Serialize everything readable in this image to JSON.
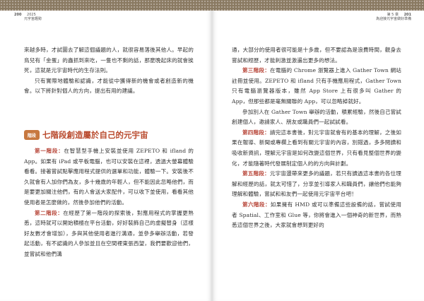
{
  "left_page": {
    "page_number": "200",
    "header_year": "2025",
    "header_title": "元宇宙趨勢",
    "intro_paragraphs": [
      "來越多時，才試圖去了解這個議題的人，就很容易落後其他人。早起的鳥兒有「金蛋」的蟲抓到來吃，一隻也不剩的話，那麼晚起床的就會挨死，這就是元宇宙時代的生存法則。",
      "只有實際地體驗和認識，才能從中獲得新的機會或者創造新的機會。以下將針對個人的方向，提出有用的建議。"
    ],
    "section_badge": "階段",
    "section_heading": "七階段創造屬於自己的元宇宙",
    "stage_paragraphs": [
      {
        "label": "第一階段：",
        "text": "在智慧型手機上安裝並使用 ZEPETO 和 ifland 的 App。如果有 iPad 或平板電腦，也可以安裝在這裡，透過大螢幕體驗看看。接著嘗試點擊應用程式提供的選單和功能，體驗一下。安裝後不久就會有人加你們為友，多十幾歲的年輕人，但不能因此忽略他們，而是要更加關注他們，有的人會送大家配件，可以收下並使用，看看其他使用者是怎麼做的，然後參加他們的活動。"
      },
      {
        "label": "第二階段：",
        "text": "在經歷了第一階段的探索後，對應用程式的掌握更熟悉，這時就可以開始積極在平台活動，好好裝飾自己的虛擬替身（這樣好友數才會增加），多與其他使用者進行溝通，並參多舉辦活動，若發起活動，有不認識的人參加並且在空間裡東張西望，我們要歡迎他們，並嘗試和他們溝"
      }
    ]
  },
  "right_page": {
    "page_number": "201",
    "header_chapter": "第 5 章",
    "header_title": "為迎接元宇宙做好準備",
    "continuation": "通，大部分的使用者很可能是十多歲，但不要認為是浪費時間，觀身去嘗試和經歷，才能刺激並激盪出更多的想法。",
    "stage_paragraphs": [
      {
        "label": "第三階段：",
        "text": "在電腦的 Chrome 瀏覽器上進入 Gather Town 網站註冊並使用。ZEPETO 和 ifland 只有手機應用程式，Gather Town 只有電腦瀏覽器版本，雖然 App Store 上有很多叫 Gather 的 App，但那些都是毫無關聯的 App，可以忽略掉就好。"
      },
      {
        "label": "",
        "text": "參加別人在 Gather Town 舉辦的活動，積累經驗，然後自己嘗試創建個人，邀請家人、朋友或職員們一起試試看。"
      },
      {
        "label": "第四階段：",
        "text": "請完這本書後，對元宇宙就會有的基本的理解，之後如果在報導、新聞或專欄上看到有關元宇宙的內容，別錯過，多多閱讀和吸收新資訊，理解元宇宙是如何改變這個世界，只有看見整個世界的變化，才能隨著時代發展制定個人的的方向與計劃。"
      },
      {
        "label": "第五階段：",
        "text": "元宇宙還帶來更多的議題，若只有讀過這本書的各位理解和經歷的話，就太可惜了，分享並引導家人和職員們，讓他們也能夠理解和體驗，嘗試和和友們一起使用元宇宙平台吧！"
      },
      {
        "label": "第六階段：",
        "text": "如果擁有 HMD 或可以準備這些設備的話，嘗試使用者 Spatial、工作室和 Glue 等，你將會進入一個神奇的新世界，而熟悉這個世界之後，大家就會想到更好的"
      }
    ]
  }
}
